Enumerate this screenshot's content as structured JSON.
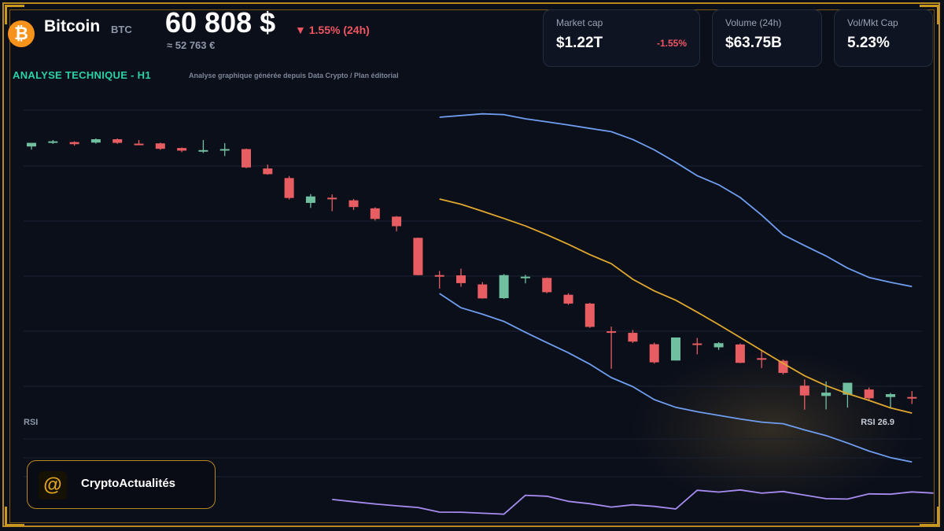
{
  "header": {
    "coin_name": "Bitcoin",
    "coin_symbol": "BTC",
    "coin_glyph": "₿",
    "price": "60 808 $",
    "price_eur": "≈ 52 763 €",
    "change_24h": "▼ 1.55% (24h)"
  },
  "analysis": {
    "label": "ANALYSE TECHNIQUE - H1",
    "subtitle": "Analyse graphique générée depuis Data Crypto / Plan éditorial"
  },
  "cards": [
    {
      "label": "Market cap",
      "value": "$1.22T",
      "change": "-1.55%"
    },
    {
      "label": "Volume (24h)",
      "value": "$63.75B"
    },
    {
      "label": "Vol/Mkt Cap",
      "value": "5.23%"
    }
  ],
  "brand": {
    "glyph": "@",
    "name": "CryptoActualités"
  },
  "colors": {
    "up": "#6fbfa0",
    "down": "#e85d61",
    "band": "#6f9ef0",
    "mid": "#e0a82e",
    "rsi": "#a68cf0",
    "accent": "#2bd1a6",
    "frame": "#b8891f"
  },
  "chart_data": {
    "type": "candlestick",
    "title": "ANALYSE TECHNIQUE - H1",
    "ylim": [
      0,
      100
    ],
    "grid": true,
    "candles": [
      {
        "o": 89.3,
        "h": 90.5,
        "l": 88.1,
        "c": 90.7
      },
      {
        "o": 90.9,
        "h": 91.8,
        "l": 90.3,
        "c": 91.3
      },
      {
        "o": 91.0,
        "h": 91.3,
        "l": 89.6,
        "c": 90.2
      },
      {
        "o": 90.8,
        "h": 92.4,
        "l": 90.4,
        "c": 92.1
      },
      {
        "o": 92.1,
        "h": 92.4,
        "l": 90.3,
        "c": 90.7
      },
      {
        "o": 90.4,
        "h": 91.8,
        "l": 89.9,
        "c": 90.3
      },
      {
        "o": 90.5,
        "h": 90.8,
        "l": 88.0,
        "c": 88.4
      },
      {
        "o": 88.7,
        "h": 88.9,
        "l": 87.1,
        "c": 87.7
      },
      {
        "o": 87.7,
        "h": 91.8,
        "l": 86.8,
        "c": 87.9
      },
      {
        "o": 88.0,
        "h": 90.6,
        "l": 85.6,
        "c": 88.3
      },
      {
        "o": 88.3,
        "h": 88.5,
        "l": 80.9,
        "c": 81.2
      },
      {
        "o": 80.8,
        "h": 82.3,
        "l": 78.4,
        "c": 78.6
      },
      {
        "o": 77.1,
        "h": 77.9,
        "l": 68.8,
        "c": 69.4
      },
      {
        "o": 67.5,
        "h": 70.9,
        "l": 65.6,
        "c": 70.0
      },
      {
        "o": 69.5,
        "h": 70.8,
        "l": 64.3,
        "c": 69.4
      },
      {
        "o": 68.5,
        "h": 69.0,
        "l": 64.8,
        "c": 65.9
      },
      {
        "o": 65.4,
        "h": 65.8,
        "l": 60.7,
        "c": 61.3
      },
      {
        "o": 62.2,
        "h": 62.4,
        "l": 56.5,
        "c": 58.5
      },
      {
        "o": 54.0,
        "h": 54.1,
        "l": 39.5,
        "c": 39.6
      },
      {
        "o": 39.6,
        "h": 41.2,
        "l": 34.4,
        "c": 39.5
      },
      {
        "o": 39.5,
        "h": 42.1,
        "l": 35.1,
        "c": 36.5
      },
      {
        "o": 36.0,
        "h": 36.9,
        "l": 30.5,
        "c": 30.6
      },
      {
        "o": 30.7,
        "h": 40.0,
        "l": 30.4,
        "c": 39.6
      },
      {
        "o": 38.9,
        "h": 39.7,
        "l": 36.4,
        "c": 39.0
      },
      {
        "o": 38.5,
        "h": 38.7,
        "l": 32.6,
        "c": 33.0
      },
      {
        "o": 32.0,
        "h": 32.6,
        "l": 28.1,
        "c": 28.6
      },
      {
        "o": 28.6,
        "h": 28.9,
        "l": 19.2,
        "c": 19.6
      },
      {
        "o": 17.9,
        "h": 19.7,
        "l": 3.4,
        "c": 17.4
      },
      {
        "o": 17.3,
        "h": 18.4,
        "l": 13.4,
        "c": 13.9
      },
      {
        "o": 12.9,
        "h": 13.5,
        "l": 5.4,
        "c": 5.9
      },
      {
        "o": 6.6,
        "h": 15.5,
        "l": 6.6,
        "c": 15.5
      },
      {
        "o": 13.2,
        "h": 15.3,
        "l": 9.0,
        "c": 12.6
      },
      {
        "o": 11.7,
        "h": 13.7,
        "l": 10.7,
        "c": 13.3
      },
      {
        "o": 12.8,
        "h": 13.2,
        "l": 5.6,
        "c": 5.7
      },
      {
        "o": 7.5,
        "h": 10.8,
        "l": 3.7,
        "c": 6.9
      },
      {
        "o": 6.5,
        "h": 7.0,
        "l": 1.2,
        "c": 1.8
      },
      {
        "o": -3.1,
        "h": -0.7,
        "l": -12.4,
        "c": -6.9
      },
      {
        "o": -7.1,
        "h": -1.5,
        "l": -12.3,
        "c": -5.8
      },
      {
        "o": -6.6,
        "h": -3.4,
        "l": -11.6,
        "c": -2.0
      },
      {
        "o": -4.6,
        "h": -3.8,
        "l": -8.6,
        "c": -8.0
      },
      {
        "o": -7.5,
        "h": -5.9,
        "l": -11.9,
        "c": -6.4
      },
      {
        "o": -7.5,
        "h": -5.2,
        "l": -10.2,
        "c": -8.0
      }
    ],
    "upper_band": [
      {
        "i": 19,
        "v": 100.6
      },
      {
        "i": 21,
        "v": 101.9
      },
      {
        "i": 22,
        "v": 101.6
      },
      {
        "i": 23,
        "v": 100.0
      },
      {
        "i": 24,
        "v": 98.8
      },
      {
        "i": 25,
        "v": 97.6
      },
      {
        "i": 26,
        "v": 96.3
      },
      {
        "i": 27,
        "v": 95.0
      },
      {
        "i": 28,
        "v": 92.0
      },
      {
        "i": 29,
        "v": 88.0
      },
      {
        "i": 30,
        "v": 83.2
      },
      {
        "i": 31,
        "v": 78.0
      },
      {
        "i": 32,
        "v": 74.5
      },
      {
        "i": 33,
        "v": 69.6
      },
      {
        "i": 34,
        "v": 62.8
      },
      {
        "i": 35,
        "v": 55.2
      },
      {
        "i": 36,
        "v": 51.0
      },
      {
        "i": 37,
        "v": 47.0
      },
      {
        "i": 38,
        "v": 42.3
      },
      {
        "i": 39,
        "v": 38.7
      },
      {
        "i": 40,
        "v": 36.8
      },
      {
        "i": 41,
        "v": 35.2
      }
    ],
    "mid_band": [
      {
        "i": 19,
        "v": 69.0
      },
      {
        "i": 20,
        "v": 67.0
      },
      {
        "i": 21,
        "v": 64.3
      },
      {
        "i": 22,
        "v": 61.5
      },
      {
        "i": 23,
        "v": 58.6
      },
      {
        "i": 24,
        "v": 55.2
      },
      {
        "i": 25,
        "v": 51.5
      },
      {
        "i": 26,
        "v": 47.5
      },
      {
        "i": 27,
        "v": 44.0
      },
      {
        "i": 28,
        "v": 38.0
      },
      {
        "i": 29,
        "v": 33.5
      },
      {
        "i": 30,
        "v": 29.9
      },
      {
        "i": 31,
        "v": 25.3
      },
      {
        "i": 32,
        "v": 20.5
      },
      {
        "i": 33,
        "v": 15.5
      },
      {
        "i": 34,
        "v": 10.5
      },
      {
        "i": 35,
        "v": 5.5
      },
      {
        "i": 36,
        "v": 0.7
      },
      {
        "i": 37,
        "v": -3.1
      },
      {
        "i": 38,
        "v": -6.2
      },
      {
        "i": 39,
        "v": -8.8
      },
      {
        "i": 40,
        "v": -11.7
      },
      {
        "i": 41,
        "v": -13.7
      }
    ],
    "lower_band": [
      {
        "i": 19,
        "v": 32.5
      },
      {
        "i": 20,
        "v": 27.0
      },
      {
        "i": 21,
        "v": 24.5
      },
      {
        "i": 22,
        "v": 21.7
      },
      {
        "i": 23,
        "v": 17.5
      },
      {
        "i": 24,
        "v": 13.5
      },
      {
        "i": 25,
        "v": 9.6
      },
      {
        "i": 26,
        "v": 5.2
      },
      {
        "i": 27,
        "v": 0.0
      },
      {
        "i": 28,
        "v": -3.5
      },
      {
        "i": 29,
        "v": -8.5
      },
      {
        "i": 30,
        "v": -11.5
      },
      {
        "i": 31,
        "v": -13.2
      },
      {
        "i": 32,
        "v": -14.6
      },
      {
        "i": 33,
        "v": -16.0
      },
      {
        "i": 34,
        "v": -17.2
      },
      {
        "i": 35,
        "v": -17.8
      },
      {
        "i": 36,
        "v": -20.2
      },
      {
        "i": 37,
        "v": -22.4
      },
      {
        "i": 38,
        "v": -25.3
      },
      {
        "i": 39,
        "v": -28.4
      },
      {
        "i": 40,
        "v": -30.9
      },
      {
        "i": 41,
        "v": -32.6
      }
    ],
    "rsi": {
      "label": "RSI",
      "value_label": "RSI 26.9",
      "ylim": [
        0,
        100
      ],
      "values": [
        {
          "i": 14,
          "v": 27.0
        },
        {
          "i": 15,
          "v": 25.4
        },
        {
          "i": 16,
          "v": 23.8
        },
        {
          "i": 17,
          "v": 22.5
        },
        {
          "i": 18,
          "v": 21.3
        },
        {
          "i": 19,
          "v": 18.0
        },
        {
          "i": 20,
          "v": 17.9
        },
        {
          "i": 21,
          "v": 17.2
        },
        {
          "i": 22,
          "v": 16.5
        },
        {
          "i": 23,
          "v": 30.0
        },
        {
          "i": 24,
          "v": 29.3
        },
        {
          "i": 25,
          "v": 25.7
        },
        {
          "i": 26,
          "v": 24.0
        },
        {
          "i": 27,
          "v": 21.6
        },
        {
          "i": 28,
          "v": 23.2
        },
        {
          "i": 29,
          "v": 22.1
        },
        {
          "i": 30,
          "v": 20.2
        },
        {
          "i": 31,
          "v": 33.6
        },
        {
          "i": 32,
          "v": 32.3
        },
        {
          "i": 33,
          "v": 33.8
        },
        {
          "i": 34,
          "v": 31.5
        },
        {
          "i": 35,
          "v": 32.7
        },
        {
          "i": 36,
          "v": 30.1
        },
        {
          "i": 37,
          "v": 27.6
        },
        {
          "i": 38,
          "v": 27.3
        },
        {
          "i": 39,
          "v": 31.0
        },
        {
          "i": 40,
          "v": 30.8
        },
        {
          "i": 41,
          "v": 32.4
        },
        {
          "i": 42,
          "v": 31.6
        }
      ]
    }
  }
}
